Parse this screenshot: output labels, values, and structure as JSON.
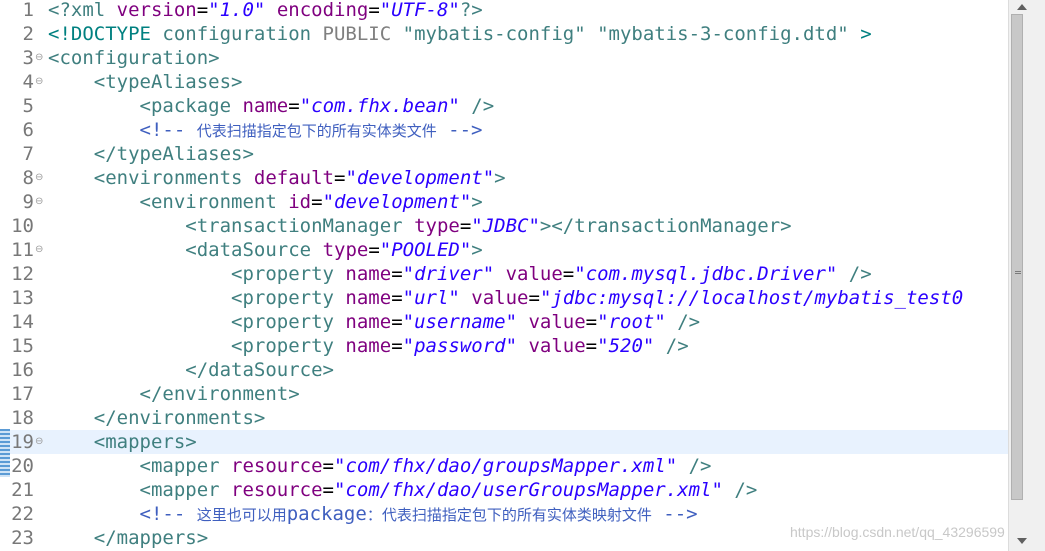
{
  "editor": {
    "current_line": 19,
    "lines": [
      {
        "n": "1",
        "fold": "",
        "tokens": [
          [
            "tag",
            "<?xml "
          ],
          [
            "attr",
            "version"
          ],
          [
            "",
            "="
          ],
          [
            "val",
            "\"1.0\""
          ],
          [
            "attr",
            " encoding"
          ],
          [
            "",
            "="
          ],
          [
            "val",
            "\"UTF-8\""
          ],
          [
            "tag",
            "?>"
          ]
        ]
      },
      {
        "n": "2",
        "fold": "",
        "tokens": [
          [
            "decl",
            "<!DOCTYPE "
          ],
          [
            "dt",
            "configuration "
          ],
          [
            "pub",
            "PUBLIC "
          ],
          [
            "dt",
            "\"mybatis-config\" \"mybatis-3-config.dtd\" "
          ],
          [
            "decl",
            ">"
          ]
        ]
      },
      {
        "n": "3",
        "fold": "⊖",
        "tokens": [
          [
            "tag",
            "<configuration>"
          ]
        ]
      },
      {
        "n": "4",
        "fold": "⊖",
        "tokens": [
          [
            "",
            "    "
          ],
          [
            "tag",
            "<typeAliases>"
          ]
        ]
      },
      {
        "n": "5",
        "fold": "",
        "tokens": [
          [
            "",
            "        "
          ],
          [
            "tag",
            "<package "
          ],
          [
            "attr",
            "name"
          ],
          [
            "",
            "="
          ],
          [
            "val",
            "\"com.fhx.bean\""
          ],
          [
            "tag",
            " />"
          ]
        ]
      },
      {
        "n": "6",
        "fold": "",
        "tokens": [
          [
            "",
            "        "
          ],
          [
            "comment",
            "<!-- "
          ],
          [
            "comment cjk",
            "代表扫描指定包下的所有实体类文件"
          ],
          [
            "comment",
            " -->"
          ]
        ]
      },
      {
        "n": "7",
        "fold": "",
        "tokens": [
          [
            "",
            "    "
          ],
          [
            "tag",
            "</typeAliases>"
          ]
        ]
      },
      {
        "n": "8",
        "fold": "⊖",
        "tokens": [
          [
            "",
            "    "
          ],
          [
            "tag",
            "<environments "
          ],
          [
            "attr",
            "default"
          ],
          [
            "",
            "="
          ],
          [
            "val",
            "\"development\""
          ],
          [
            "tag",
            ">"
          ]
        ]
      },
      {
        "n": "9",
        "fold": "⊖",
        "tokens": [
          [
            "",
            "        "
          ],
          [
            "tag",
            "<environment "
          ],
          [
            "attr",
            "id"
          ],
          [
            "",
            "="
          ],
          [
            "val",
            "\"development\""
          ],
          [
            "tag",
            ">"
          ]
        ]
      },
      {
        "n": "10",
        "fold": "",
        "tokens": [
          [
            "",
            "            "
          ],
          [
            "tag",
            "<transactionManager "
          ],
          [
            "attr",
            "type"
          ],
          [
            "",
            "="
          ],
          [
            "val",
            "\"JDBC\""
          ],
          [
            "tag",
            "></transactionManager>"
          ]
        ]
      },
      {
        "n": "11",
        "fold": "⊖",
        "tokens": [
          [
            "",
            "            "
          ],
          [
            "tag",
            "<dataSource "
          ],
          [
            "attr",
            "type"
          ],
          [
            "",
            "="
          ],
          [
            "val",
            "\"POOLED\""
          ],
          [
            "tag",
            ">"
          ]
        ]
      },
      {
        "n": "12",
        "fold": "",
        "tokens": [
          [
            "",
            "                "
          ],
          [
            "tag",
            "<property "
          ],
          [
            "attr",
            "name"
          ],
          [
            "",
            "="
          ],
          [
            "val",
            "\"driver\""
          ],
          [
            "attr",
            " value"
          ],
          [
            "",
            "="
          ],
          [
            "val",
            "\"com.mysql.jdbc.Driver\""
          ],
          [
            "tag",
            " />"
          ]
        ]
      },
      {
        "n": "13",
        "fold": "",
        "tokens": [
          [
            "",
            "                "
          ],
          [
            "tag",
            "<property "
          ],
          [
            "attr",
            "name"
          ],
          [
            "",
            "="
          ],
          [
            "val",
            "\"url\""
          ],
          [
            "attr",
            " value"
          ],
          [
            "",
            "="
          ],
          [
            "val",
            "\"jdbc:mysql://localhost/mybatis_test0"
          ]
        ]
      },
      {
        "n": "14",
        "fold": "",
        "tokens": [
          [
            "",
            "                "
          ],
          [
            "tag",
            "<property "
          ],
          [
            "attr",
            "name"
          ],
          [
            "",
            "="
          ],
          [
            "val",
            "\"username\""
          ],
          [
            "attr",
            " value"
          ],
          [
            "",
            "="
          ],
          [
            "val",
            "\"root\""
          ],
          [
            "tag",
            " />"
          ]
        ]
      },
      {
        "n": "15",
        "fold": "",
        "tokens": [
          [
            "",
            "                "
          ],
          [
            "tag",
            "<property "
          ],
          [
            "attr",
            "name"
          ],
          [
            "",
            "="
          ],
          [
            "val",
            "\"password\""
          ],
          [
            "attr",
            " value"
          ],
          [
            "",
            "="
          ],
          [
            "val",
            "\"520\""
          ],
          [
            "tag",
            " />"
          ]
        ]
      },
      {
        "n": "16",
        "fold": "",
        "tokens": [
          [
            "",
            "            "
          ],
          [
            "tag",
            "</dataSource>"
          ]
        ]
      },
      {
        "n": "17",
        "fold": "",
        "tokens": [
          [
            "",
            "        "
          ],
          [
            "tag",
            "</environment>"
          ]
        ]
      },
      {
        "n": "18",
        "fold": "",
        "tokens": [
          [
            "",
            "    "
          ],
          [
            "tag",
            "</environments>"
          ]
        ]
      },
      {
        "n": "19",
        "fold": "⊖",
        "tokens": [
          [
            "",
            "    "
          ],
          [
            "tag",
            "<mappers>"
          ]
        ]
      },
      {
        "n": "20",
        "fold": "",
        "tokens": [
          [
            "",
            "        "
          ],
          [
            "tag",
            "<mapper "
          ],
          [
            "attr",
            "resource"
          ],
          [
            "",
            "="
          ],
          [
            "val",
            "\"com/fhx/dao/groupsMapper.xml\""
          ],
          [
            "tag",
            " />"
          ]
        ]
      },
      {
        "n": "21",
        "fold": "",
        "tokens": [
          [
            "",
            "        "
          ],
          [
            "tag",
            "<mapper "
          ],
          [
            "attr",
            "resource"
          ],
          [
            "",
            "="
          ],
          [
            "val",
            "\"com/fhx/dao/userGroupsMapper.xml\""
          ],
          [
            "tag",
            " />"
          ]
        ]
      },
      {
        "n": "22",
        "fold": "",
        "tokens": [
          [
            "",
            "        "
          ],
          [
            "comment",
            "<!-- "
          ],
          [
            "comment cjk",
            "这里也可以用"
          ],
          [
            "comment",
            "package"
          ],
          [
            "comment cjk",
            "：代表扫描指定包下的所有实体类映射文件"
          ],
          [
            "comment",
            " -->"
          ]
        ]
      },
      {
        "n": "23",
        "fold": "",
        "tokens": [
          [
            "",
            "    "
          ],
          [
            "tag",
            "</mappers>"
          ]
        ]
      }
    ]
  },
  "watermark": "https://blog.csdn.net/qq_43296599"
}
